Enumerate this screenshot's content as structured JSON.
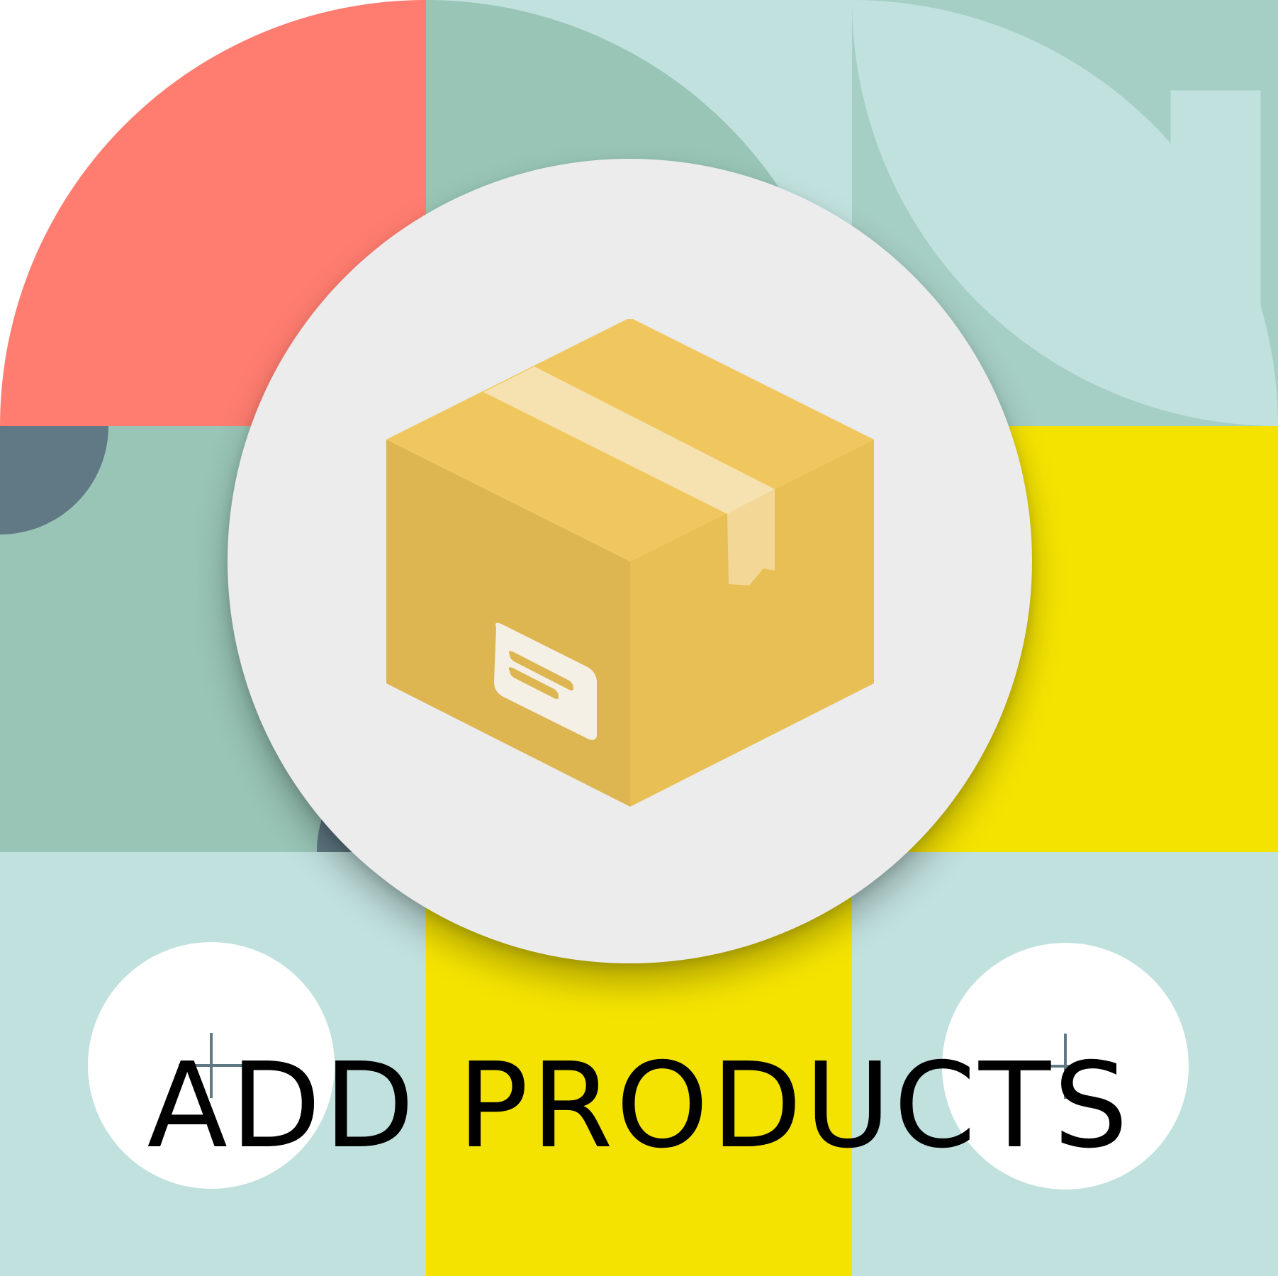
{
  "title": "ADD PRODUCTS",
  "icons": {
    "center": "package-box-icon",
    "left_button": "plus-icon",
    "right_button": "plus-icon"
  },
  "colors": {
    "coral": "#ff7d70",
    "sage": "#98c5b6",
    "mint": "#a5cec4",
    "pale_mint": "#c1e1de",
    "slate": "#607985",
    "yellow": "#f4e300",
    "disc": "#ececec",
    "box_top": "#f0c75e",
    "box_left": "#ddb652",
    "box_right": "#e7bf55",
    "tape": "#f6e2b0"
  }
}
